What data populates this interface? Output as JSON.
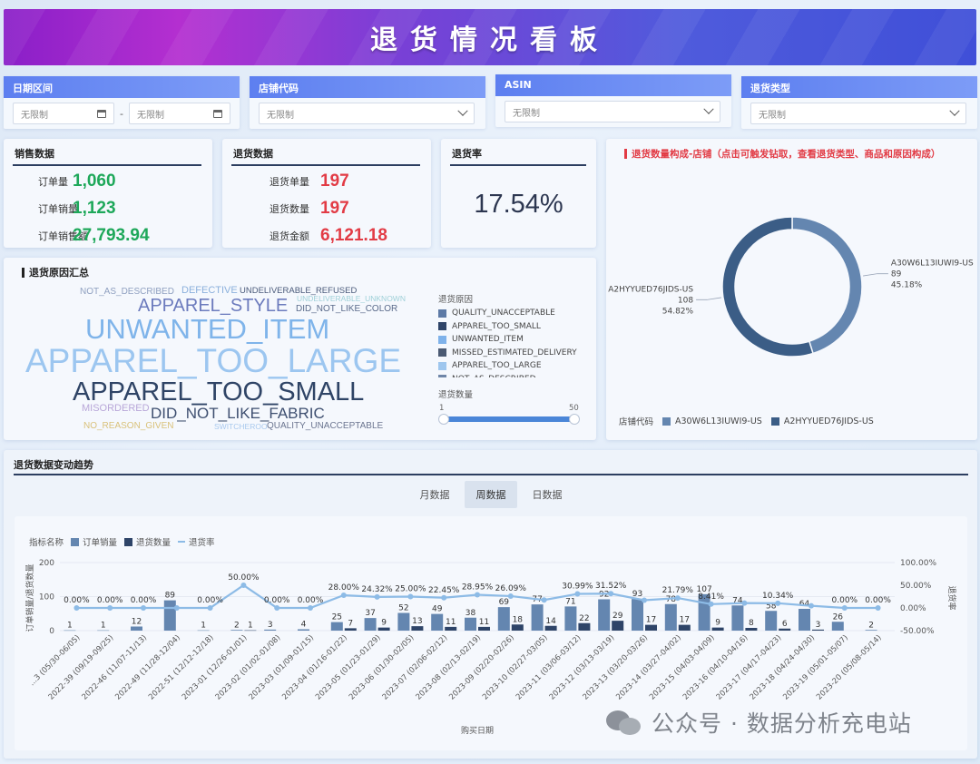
{
  "header": {
    "title": "退货情况看板"
  },
  "filters": {
    "date": {
      "label": "日期区间",
      "start_placeholder": "无限制",
      "end_placeholder": "无限制",
      "separator": "-"
    },
    "store": {
      "label": "店铺代码",
      "value": "无限制"
    },
    "asin": {
      "label": "ASIN",
      "value": "无限制"
    },
    "return_type": {
      "label": "退货类型",
      "value": "无限制"
    }
  },
  "sales": {
    "title": "销售数据",
    "rows": [
      {
        "label": "订单量",
        "value": "1,060"
      },
      {
        "label": "订单销量",
        "value": "1,123"
      },
      {
        "label": "订单销售额",
        "value": "27,793.94"
      }
    ]
  },
  "returns": {
    "title": "退货数据",
    "rows": [
      {
        "label": "退货单量",
        "value": "197"
      },
      {
        "label": "退货数量",
        "value": "197"
      },
      {
        "label": "退货金额",
        "value": "6,121.18"
      }
    ]
  },
  "return_rate": {
    "title": "退货率",
    "value": "17.54%"
  },
  "reasons": {
    "title": "退货原因汇总",
    "cloud": [
      {
        "text": "NOT_AS_DESCRIBED",
        "color": "#8fa0c0"
      },
      {
        "text": "DEFECTIVE",
        "color": "#8bb0dc"
      },
      {
        "text": "UNDELIVERABLE_REFUSED",
        "color": "#4a5a7a"
      },
      {
        "text": "APPAREL_STYLE",
        "color": "#6c7bbd"
      },
      {
        "text": "UNDELIVERABLE_UNKNOWN",
        "color": "#9fd0d8"
      },
      {
        "text": "DID_NOT_LIKE_COLOR",
        "color": "#5a6a8a"
      },
      {
        "text": "UNWANTED_ITEM",
        "color": "#7fb4ea"
      },
      {
        "text": "APPAREL_TOO_LARGE",
        "color": "#9cc6f0"
      },
      {
        "text": "APPAREL_TOO_SMALL",
        "color": "#2f4466"
      },
      {
        "text": "MISORDERED",
        "color": "#b8a6d8"
      },
      {
        "text": "DID_NOT_LIKE_FABRIC",
        "color": "#3e4f70"
      },
      {
        "text": "NO_REASON_GIVEN",
        "color": "#d9c17a"
      },
      {
        "text": "SWITCHEROO",
        "color": "#a9c9ee"
      },
      {
        "text": "QUALITY_UNACCEPTABLE",
        "color": "#6b7590"
      }
    ],
    "legend_title": "退货原因",
    "legend": [
      {
        "text": "QUALITY_UNACCEPTABLE",
        "color": "#5d7aa6"
      },
      {
        "text": "APPAREL_TOO_SMALL",
        "color": "#2e4468"
      },
      {
        "text": "UNWANTED_ITEM",
        "color": "#7fb2ea"
      },
      {
        "text": "MISSED_ESTIMATED_DELIVERY",
        "color": "#4b5a73"
      },
      {
        "text": "APPAREL_TOO_LARGE",
        "color": "#9ec6ee"
      },
      {
        "text": "NOT_AS_DESCRIBED",
        "color": "#6f86a8"
      }
    ],
    "slider_label": "退货数量",
    "slider_min": "1",
    "slider_max": "50"
  },
  "donut": {
    "title": "退货数量构成-店铺（点击可触发钻取，查看退货类型、商品和原因构成）",
    "legend_title": "店铺代码",
    "chart_data": {
      "type": "pie",
      "slices": [
        {
          "name": "A30W6L13IUWI9-US",
          "value": 89,
          "percent": "45.18%",
          "color": "#6486b0"
        },
        {
          "name": "A2HYYUED76JIDS-US",
          "value": 108,
          "percent": "54.82%",
          "color": "#3b5d86"
        }
      ]
    }
  },
  "trend": {
    "title": "退货数据变动趋势",
    "tabs": [
      {
        "label": "月数据",
        "active": false
      },
      {
        "label": "周数据",
        "active": true
      },
      {
        "label": "日数据",
        "active": false
      }
    ],
    "legend_label": "指标名称",
    "xlabel": "购买日期",
    "ylabel_left": "订单销量/退货数量",
    "ylabel_right": "退货率",
    "chart_data": {
      "type": "bar",
      "categories": [
        "...3 (05/30-06/05)",
        "2022-39 (09/19-09/25)",
        "2022-46 (11/07-11/13)",
        "2022-49 (11/28-12/04)",
        "2022-51 (12/12-12/18)",
        "2023-01 (12/26-01/01)",
        "2023-02 (01/02-01/08)",
        "2023-03 (01/09-01/15)",
        "2023-04 (01/16-01/22)",
        "2023-05 (01/23-01/29)",
        "2023-06 (01/30-02/05)",
        "2023-07 (02/06-02/12)",
        "2023-08 (02/13-02/19)",
        "2023-09 (02/20-02/26)",
        "2023-10 (02/27-03/05)",
        "2023-11 (03/06-03/12)",
        "2023-12 (03/13-03/19)",
        "2023-13 (03/20-03/26)",
        "2023-14 (03/27-04/02)",
        "2023-15 (04/03-04/09)",
        "2023-16 (04/10-04/16)",
        "2023-17 (04/17-04/23)",
        "2023-18 (04/24-04/30)",
        "2023-19 (05/01-05/07)",
        "2023-20 (05/08-05/14)"
      ],
      "series": [
        {
          "name": "订单销量",
          "color": "#6486b0",
          "values": [
            1,
            1,
            12,
            89,
            1,
            2,
            3,
            4,
            25,
            37,
            52,
            49,
            38,
            69,
            77,
            71,
            92,
            93,
            78,
            107,
            74,
            58,
            64,
            26,
            2
          ]
        },
        {
          "name": "退货数量",
          "color": "#2e4468",
          "values": [
            0,
            0,
            0,
            0,
            0,
            1,
            0,
            0,
            7,
            9,
            13,
            11,
            11,
            18,
            14,
            22,
            29,
            17,
            17,
            9,
            8,
            6,
            3,
            0,
            0
          ]
        },
        {
          "name": "退货率",
          "color": "#8dbbe6",
          "axis": "right",
          "values": [
            0,
            0,
            0,
            0,
            0,
            50,
            0,
            0,
            28,
            24.32,
            25,
            22.45,
            28.95,
            26.09,
            17.5,
            30.99,
            31.52,
            17,
            21.79,
            8.41,
            10.81,
            10.34,
            4.69,
            0,
            0
          ]
        }
      ],
      "rate_labels": [
        "0.00%",
        "0.00%",
        "0.00%",
        "",
        "0.00%",
        "50.00%",
        "0.00%",
        "0.00%",
        "28.00%",
        "24.32%",
        "25.00%",
        "22.45%",
        "28.95%",
        "26.09%",
        "",
        "30.99%",
        "31.52%",
        "",
        "21.79%",
        "8.41%",
        "",
        "10.34%",
        "",
        "0.00%",
        "0.00%"
      ],
      "ylim_left": [
        0,
        200
      ],
      "left_ticks": [
        "200",
        "100",
        "0"
      ],
      "ylim_right": [
        -50,
        100
      ],
      "right_ticks": [
        "100.00%",
        "50.00%",
        "0.00%",
        "-50.00%"
      ]
    }
  },
  "watermark": {
    "text": "公众号 · 数据分析充电站"
  }
}
